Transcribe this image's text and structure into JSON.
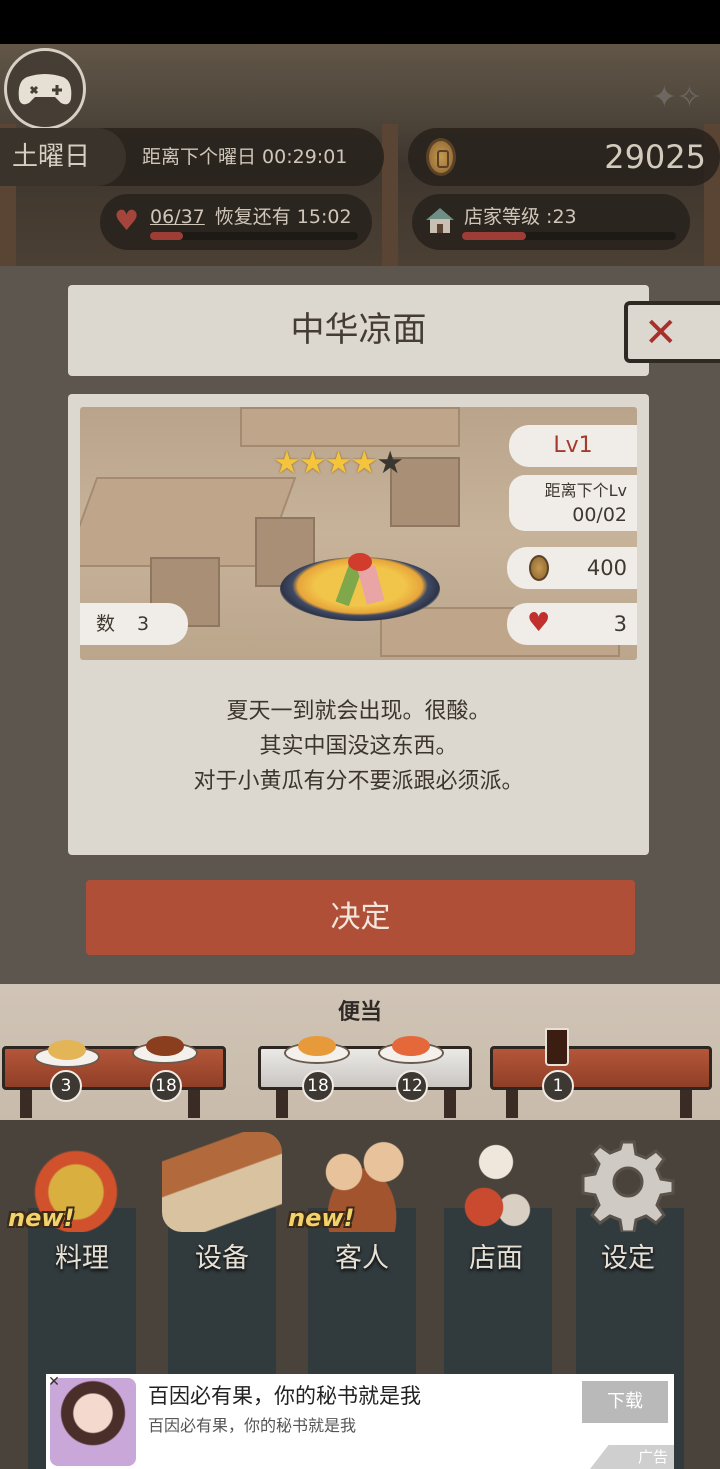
{
  "hud": {
    "weekday": "土曜日",
    "countdown": "距离下个曜日 00:29:01",
    "coins": "29025",
    "hearts": "06/37",
    "recover": "恢复还有 15:02",
    "hearts_fill": 0.16,
    "shop_level": "店家等级 :23",
    "shop_fill": 0.3
  },
  "dialog": {
    "title": "中华凉面",
    "stars_filled": 4,
    "stars_total": 5,
    "level": "Lv1",
    "next_level_label": "距离下个Lv",
    "next_level_value": "00/02",
    "price": "400",
    "hearts": "3",
    "count_label": "数",
    "count_value": "3",
    "description": [
      "夏天一到就会出现。很酸。",
      "其实中国没这东西。",
      "对于小黄瓜有分不要派跟必须派。"
    ],
    "confirm": "决定"
  },
  "counter": {
    "label": "便当",
    "slots": [
      "3",
      "18",
      "18",
      "12",
      "1"
    ]
  },
  "nav": [
    {
      "label": "料理",
      "new": "new!"
    },
    {
      "label": "设备",
      "new": ""
    },
    {
      "label": "客人",
      "new": "new!"
    },
    {
      "label": "店面",
      "new": ""
    },
    {
      "label": "设定",
      "new": ""
    }
  ],
  "ad": {
    "title": "百因必有果，你的秘书就是我",
    "subtitle": "百因必有果，你的秘书就是我",
    "button": "下载",
    "tag": "广告",
    "close": "✕"
  },
  "colors": {
    "accent": "#b04f38",
    "panel": "#dcd7cf",
    "heart": "#c0302c",
    "star": "#f3c43c"
  }
}
